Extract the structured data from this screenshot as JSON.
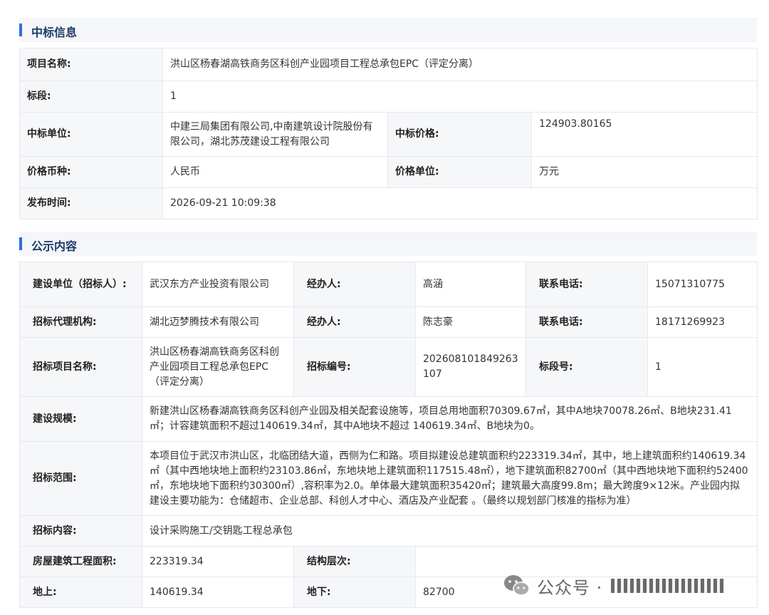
{
  "section1": {
    "title": "中标信息"
  },
  "bid_info": {
    "project_name_label": "项目名称:",
    "project_name": "洪山区杨春湖高铁商务区科创产业园项目工程总承包EPC（评定分离）",
    "section_label": "标段:",
    "section": "1",
    "winner_label": "中标单位:",
    "winner": "中建三局集团有限公司,中南建筑设计院股份有限公司，湖北苏茂建设工程有限公司",
    "price_label": "中标价格:",
    "price": "124903.80165",
    "currency_label": "价格币种:",
    "currency": "人民币",
    "unit_label": "价格单位:",
    "unit": "万元",
    "publish_time_label": "发布时间:",
    "publish_time": "2026-09-21 10:09:38"
  },
  "section2": {
    "title": "公示内容"
  },
  "notice": {
    "builder_label": "建设单位（招标人）:",
    "builder": "武汉东方产业投资有限公司",
    "handler_label": "经办人:",
    "handler1": "高涵",
    "phone_label": "联系电话:",
    "phone1": "15071310775",
    "agency_label": "招标代理机构:",
    "agency": "湖北迈梦腾技术有限公司",
    "handler2": "陈志豪",
    "phone2": "18171269923",
    "project_label": "招标项目名称:",
    "project": "洪山区杨春湖高铁商务区科创产业园项目工程总承包EPC（评定分离）",
    "code_label": "招标编号:",
    "code": "202608101849263107",
    "segment_label": "标段号:",
    "segment": "1",
    "scale_label": "建设规模:",
    "scale": "新建洪山区杨春湖高铁商务区科创产业园及相关配套设施等，项目总用地面积70309.67㎡，其中A地块70078.26㎡、B地块231.41㎡；计容建筑面积不超过140619.34㎡，其中A地块不超过 140619.34㎡、B地块为0。",
    "scope_label": "招标范围:",
    "scope": "本项目位于武汉市洪山区，北临团结大道，西侧为仁和路。项目拟建设总建筑面积约223319.34㎡，其中，地上建筑面积约140619.34㎡（其中西地块地上面积约23103.86㎡，东地块地上建筑面积117515.48㎡），地下建筑面积82700㎡（其中西地块地下面积约52400㎡，东地块地下面积约30300㎡）,容积率为2.0。单体最大建筑面积35420㎡；建筑最大高度99.8m；最大跨度9×12米。产业园内拟建设主要功能为：仓储超市、企业总部、科创人才中心、酒店及产业配套 。（最终以规划部门核准的指标为准）",
    "content_label": "招标内容:",
    "content": "设计采购施工/交钥匙工程总承包",
    "area_label": "房屋建筑工程面积:",
    "area": "223319.34",
    "floors_label": "结构层次:",
    "floors": "",
    "above_label": "地上:",
    "above": "140619.34",
    "below_label": "地下:",
    "below": "82700"
  },
  "watermark": {
    "text": "公众号 ·",
    "icon": "wechat-icon"
  }
}
